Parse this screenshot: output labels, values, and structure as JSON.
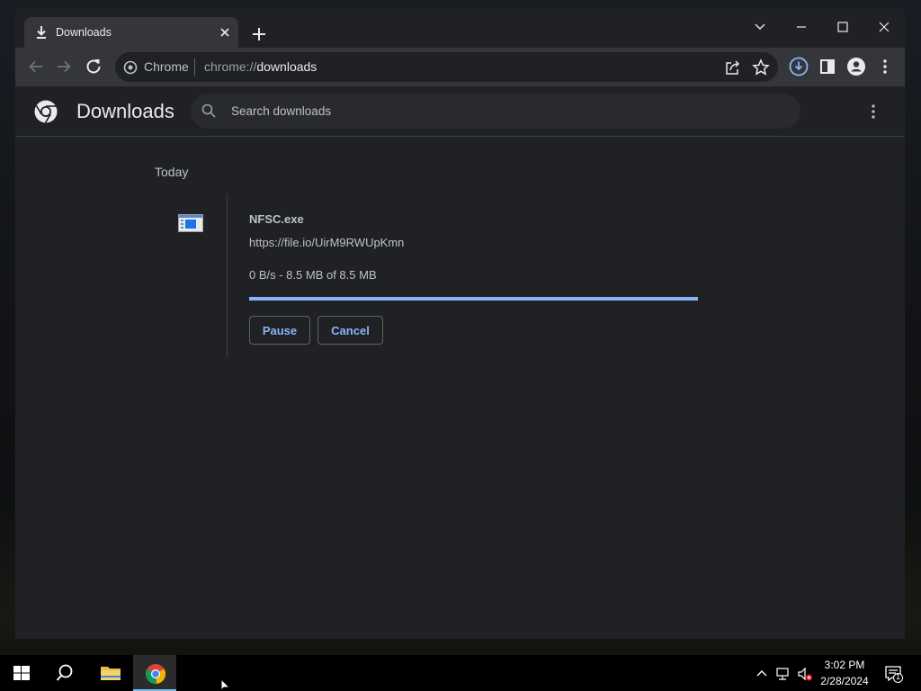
{
  "browser": {
    "tab": {
      "title": "Downloads"
    },
    "omnibox": {
      "chip_label": "Chrome",
      "url_scheme": "chrome://",
      "url_host": "downloads"
    }
  },
  "page": {
    "title": "Downloads",
    "search": {
      "placeholder": "Search downloads",
      "value": ""
    }
  },
  "downloads": {
    "section_label": "Today",
    "items": [
      {
        "file_name": "NFSC.exe",
        "url": "https://file.io/UirM9RWUpKmn",
        "status": "0 B/s - 8.5 MB of 8.5 MB",
        "progress": 1.0,
        "pause_label": "Pause",
        "cancel_label": "Cancel"
      }
    ]
  },
  "taskbar": {
    "time": "3:02 PM",
    "date": "2/28/2024",
    "notification_count": "1"
  },
  "colors": {
    "accent": "#8ab4f8",
    "background": "#202124",
    "toolbar": "#35363a",
    "text_secondary": "#bdc1c6"
  }
}
